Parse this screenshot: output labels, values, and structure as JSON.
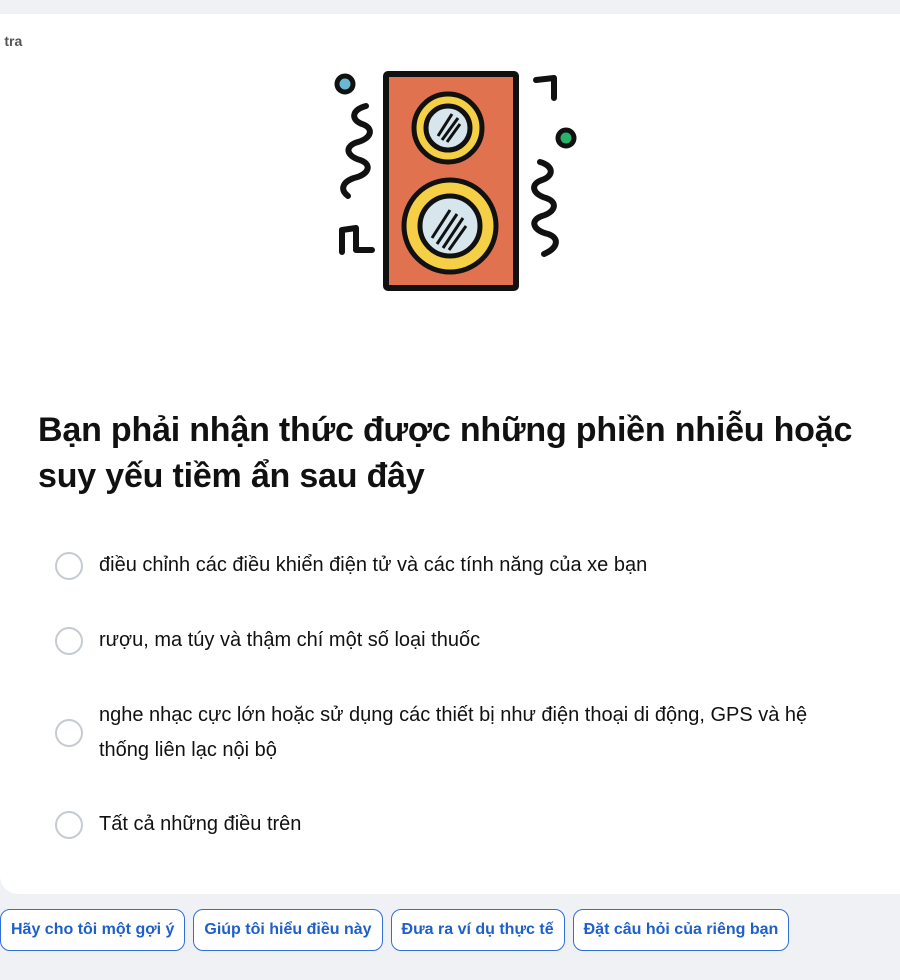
{
  "breadcrumb": "m tra",
  "question": "Bạn phải nhận thức được những phiền nhiễu hoặc suy yếu tiềm ẩn sau đây",
  "options": [
    "điều chỉnh các điều khiển điện tử và các tính năng của xe bạn",
    "rượu, ma túy và thậm chí một số loại thuốc",
    "nghe nhạc cực lớn hoặc sử dụng các thiết bị như điện thoại di động, GPS và hệ thống liên lạc nội bộ",
    "Tất cả những điều trên"
  ],
  "suggestions": [
    "Hãy cho tôi một gợi ý",
    "Giúp tôi hiểu điều này",
    "Đưa ra ví dụ thực tế",
    "Đặt câu hỏi của riêng bạn"
  ],
  "icons": {
    "illustration": "speaker-illustration"
  },
  "colors": {
    "accent": "#1f5fc9",
    "speaker_body": "#e07250",
    "speaker_ring": "#f5cf45",
    "speaker_cone": "#d6e6ec",
    "dot_blue": "#6bb8d6",
    "dot_green": "#28b26a"
  }
}
